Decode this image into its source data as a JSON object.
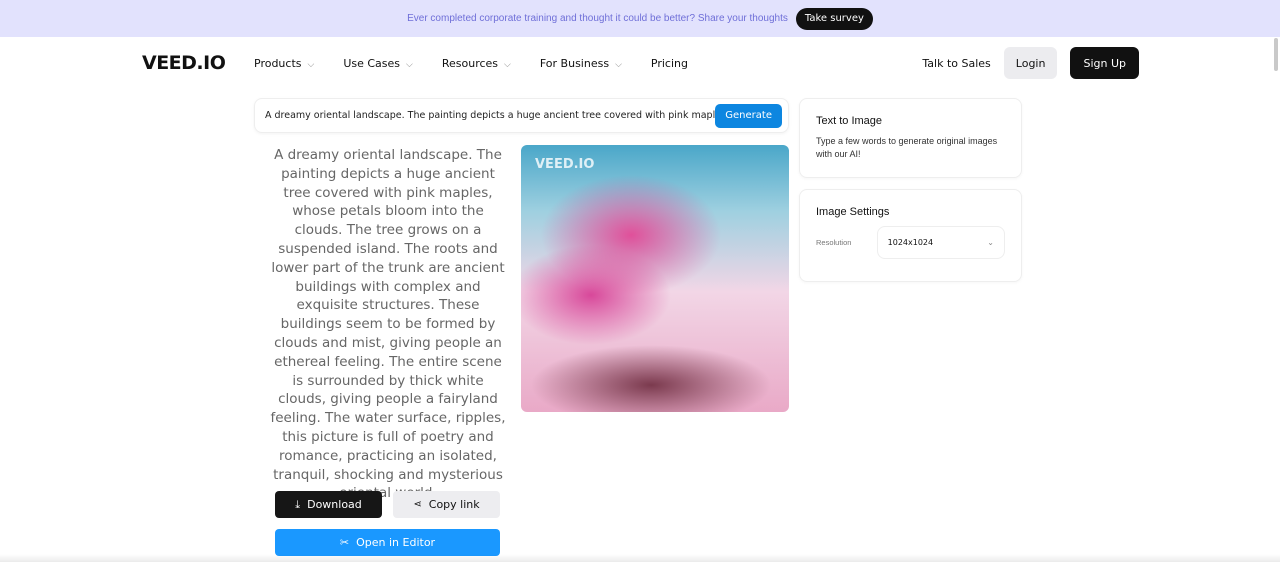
{
  "banner": {
    "text": "Ever completed corporate training and thought it could be better? Share your thoughts",
    "button": "Take survey"
  },
  "nav": {
    "logo": "VEED.IO",
    "items": [
      {
        "label": "Products",
        "chevron": true
      },
      {
        "label": "Use Cases",
        "chevron": true
      },
      {
        "label": "Resources",
        "chevron": true
      },
      {
        "label": "For Business",
        "chevron": true
      },
      {
        "label": "Pricing",
        "chevron": false
      }
    ],
    "talk_to_sales": "Talk to Sales",
    "login": "Login",
    "signup": "Sign Up"
  },
  "prompt": {
    "value": "A dreamy oriental landscape. The painting depicts a huge ancient tree covered with pink maples, whose petals bloom into the clouds.",
    "button": "Generate"
  },
  "result": {
    "description": "A dreamy oriental landscape. The painting depicts a huge ancient tree covered with pink maples, whose petals bloom into the clouds. The tree grows on a suspended island. The roots and lower part of the trunk are ancient buildings with complex and exquisite structures. These buildings seem to be formed by clouds and mist, giving people an ethereal feeling. The entire scene is surrounded by thick white clouds, giving people a fairyland feeling. The water surface, ripples, this picture is full of poetry and romance, practicing an isolated, tranquil, shocking and mysterious oriental world.",
    "watermark": "VEED.IO",
    "download": "Download",
    "copy_link": "Copy link",
    "open_editor": "Open in Editor"
  },
  "sidebar": {
    "info_title": "Text to Image",
    "info_text": "Type a few words to generate original images with our AI!",
    "settings_title": "Image Settings",
    "resolution_label": "Resolution",
    "resolution_value": "1024x1024"
  },
  "colors": {
    "banner_bg": "#e2e2fd",
    "generate": "#0d86e0",
    "editor": "#1a98ff",
    "dark": "#161616"
  }
}
